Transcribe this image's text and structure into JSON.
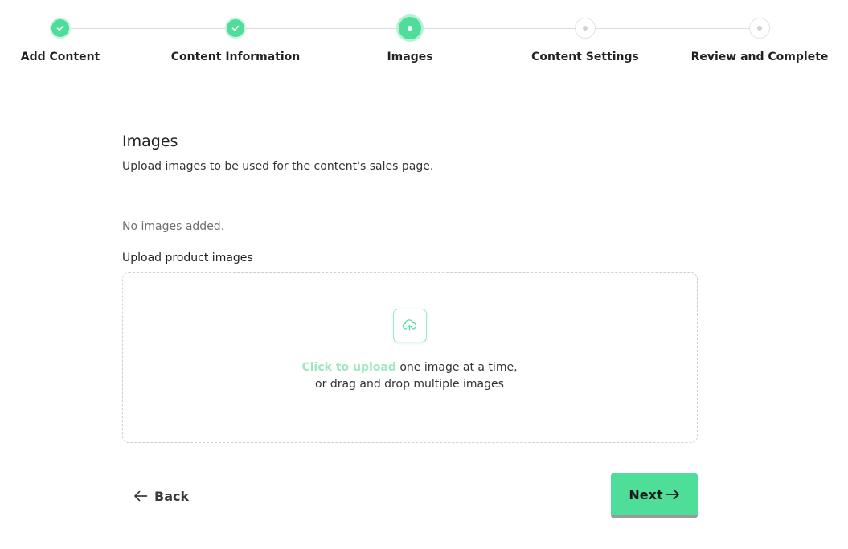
{
  "stepper": {
    "steps": [
      {
        "label": "Add Content",
        "status": "completed"
      },
      {
        "label": "Content Information",
        "status": "completed"
      },
      {
        "label": "Images",
        "status": "current"
      },
      {
        "label": "Content Settings",
        "status": "upcoming"
      },
      {
        "label": "Review and Complete",
        "status": "upcoming"
      }
    ]
  },
  "section": {
    "title": "Images",
    "description": "Upload images to be used for the content's sales page."
  },
  "images": {
    "empty_message": "No images added."
  },
  "upload": {
    "label": "Upload product images",
    "icon": "cloud-upload-icon",
    "link_text": "Click to upload",
    "line1_rest": " one image at a time,",
    "line2": "or drag and drop multiple images"
  },
  "footer": {
    "back_label": "Back",
    "back_icon": "arrow-left-icon",
    "next_label": "Next",
    "next_icon": "arrow-right-icon"
  },
  "colors": {
    "accent": "#4fdd9a",
    "accent_light": "#9ee8c3",
    "pending": "#d2d2d2"
  }
}
